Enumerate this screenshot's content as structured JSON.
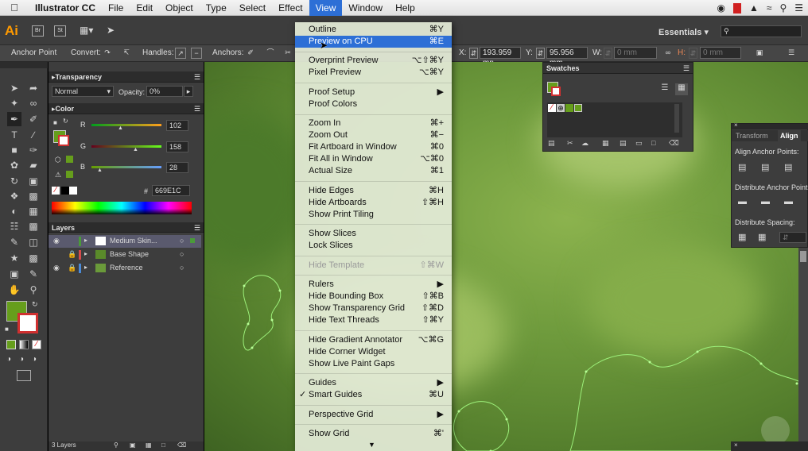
{
  "menubar": {
    "app": "Illustrator CC",
    "items": [
      "File",
      "Edit",
      "Object",
      "Type",
      "Select",
      "Effect",
      "View",
      "Window",
      "Help"
    ],
    "active": "View"
  },
  "appbar": {
    "logo": "Ai",
    "bridge": "Br",
    "stock": "St",
    "workspace": "Essentials"
  },
  "control": {
    "tool": "Anchor Point",
    "convert": "Convert:",
    "handles": "Handles:",
    "anchors": "Anchors:",
    "x_label": "X:",
    "x_value": "193.959 mn",
    "y_label": "Y:",
    "y_value": "95.956 mm",
    "w_label": "W:",
    "w_value": "0 mm",
    "h_label": "H:",
    "h_value": "0 mm"
  },
  "transparency": {
    "title": "Transparency",
    "mode": "Normal",
    "opacity_label": "Opacity:",
    "opacity": "0%"
  },
  "color": {
    "title": "Color",
    "r_label": "R",
    "r": "102",
    "g_label": "G",
    "g": "158",
    "b_label": "B",
    "b": "28",
    "hex_label": "#",
    "hex": "669E1C",
    "fill": "#669e1c"
  },
  "layers": {
    "title": "Layers",
    "rows": [
      {
        "name": "Medium Skin...",
        "color": "#4a9a3a"
      },
      {
        "name": "Base Shape",
        "color": "#d54b4b"
      },
      {
        "name": "Reference",
        "color": "#4a8ad8"
      }
    ],
    "footer": "3 Layers"
  },
  "swatches": {
    "title": "Swatches"
  },
  "align": {
    "tab1": "Transform",
    "tab2": "Align",
    "s1": "Align Anchor Points:",
    "s2": "Distribute Anchor Point",
    "s3": "Distribute Spacing:"
  },
  "menu": {
    "items": [
      {
        "label": "Outline",
        "key": "⌘Y"
      },
      {
        "label": "Preview on CPU",
        "key": "⌘E",
        "highlight": true
      },
      {
        "label": "Overprint Preview",
        "key": "⌥⇧⌘Y"
      },
      {
        "label": "Pixel Preview",
        "key": "⌥⌘Y"
      },
      {
        "label": "Proof Setup",
        "key": "▶"
      },
      {
        "label": "Proof Colors",
        "key": ""
      },
      {
        "label": "Zoom In",
        "key": "⌘+"
      },
      {
        "label": "Zoom Out",
        "key": "⌘−"
      },
      {
        "label": "Fit Artboard in Window",
        "key": "⌘0"
      },
      {
        "label": "Fit All in Window",
        "key": "⌥⌘0"
      },
      {
        "label": "Actual Size",
        "key": "⌘1"
      },
      {
        "label": "Hide Edges",
        "key": "⌘H"
      },
      {
        "label": "Hide Artboards",
        "key": "⇧⌘H"
      },
      {
        "label": "Show Print Tiling",
        "key": ""
      },
      {
        "label": "Show Slices",
        "key": ""
      },
      {
        "label": "Lock Slices",
        "key": ""
      },
      {
        "label": "Hide Template",
        "key": "⇧⌘W",
        "disabled": true
      },
      {
        "label": "Rulers",
        "key": "▶"
      },
      {
        "label": "Hide Bounding Box",
        "key": "⇧⌘B"
      },
      {
        "label": "Show Transparency Grid",
        "key": "⇧⌘D"
      },
      {
        "label": "Hide Text Threads",
        "key": "⇧⌘Y"
      },
      {
        "label": "Hide Gradient Annotator",
        "key": "⌥⌘G"
      },
      {
        "label": "Hide Corner Widget",
        "key": ""
      },
      {
        "label": "Show Live Paint Gaps",
        "key": ""
      },
      {
        "label": "Guides",
        "key": "▶"
      },
      {
        "label": "Smart Guides",
        "key": "⌘U",
        "checked": true
      },
      {
        "label": "Perspective Grid",
        "key": "▶"
      },
      {
        "label": "Show Grid",
        "key": "⌘'"
      }
    ],
    "more": "▼"
  }
}
